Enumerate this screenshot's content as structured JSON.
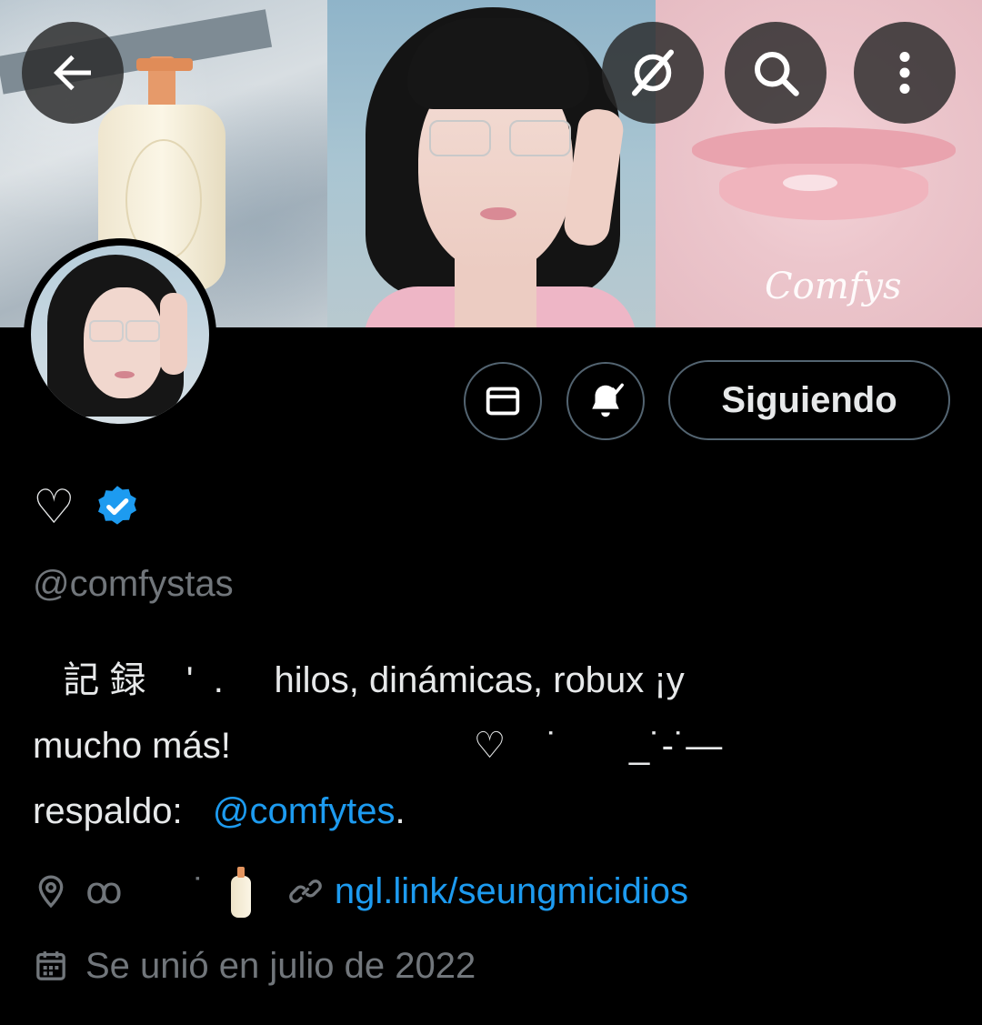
{
  "banner": {
    "watermark": "Comfys"
  },
  "header_actions": {
    "back_icon": "arrow-left-icon",
    "grok_icon": "grok-slash-icon",
    "search_icon": "search-icon",
    "more_icon": "more-vertical-icon"
  },
  "actions": {
    "message_icon": "envelope-icon",
    "notify_icon": "bell-check-icon",
    "follow_label": "Siguiendo"
  },
  "profile": {
    "display_name": "♡",
    "verified": true,
    "handle": "@comfystas",
    "bio_line1": "   記 録    '  .     hilos, dinámicas, robux ¡y",
    "bio_line2": "mucho más!                        ♡    ˙       _˙-˙—",
    "bio_line3_prefix": "respaldo:   ",
    "bio_mention": "@comfytes",
    "bio_line3_suffix": ".",
    "location": "ꝏ       ˙",
    "website": "ngl.link/seungmicidios",
    "joined": "Se unió en julio de 2022"
  },
  "colors": {
    "background": "#000000",
    "text_primary": "#e7e9ea",
    "text_secondary": "#71767b",
    "accent": "#1d9bf0",
    "border": "#536471"
  }
}
